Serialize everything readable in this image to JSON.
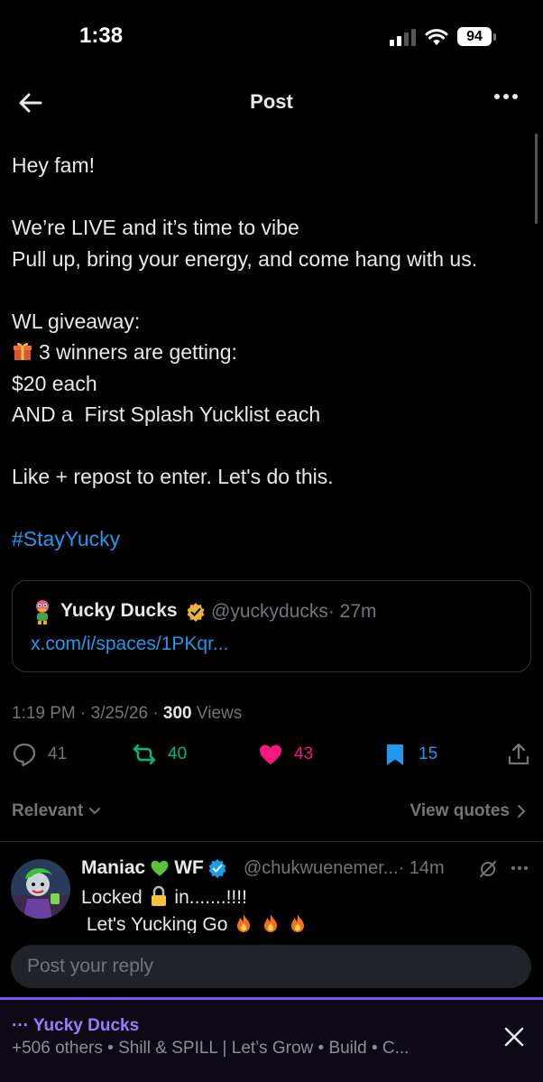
{
  "status_bar": {
    "time": "1:38",
    "battery": "94"
  },
  "nav": {
    "title": "Post"
  },
  "post": {
    "lines": [
      "Hey fam!",
      "",
      "We’re LIVE and it’s time to vibe",
      "Pull up, bring your energy, and come hang with us.",
      "",
      "WL giveaway:",
      "3 winners are getting:",
      "$20 each",
      "AND a  First Splash Yucklist each",
      "",
      "Like + repost to enter. Let's do this.",
      ""
    ],
    "hashtag": "#StayYucky"
  },
  "quote": {
    "name": "Yucky Ducks",
    "handle": "@yuckyducks",
    "time": "· 27m",
    "link": "x.com/i/spaces/1PKqr..."
  },
  "meta": {
    "time": "1:19 PM · 3/25/26 · ",
    "views_count": "300",
    "views_label": " Views"
  },
  "actions": {
    "replies": "41",
    "reposts": "40",
    "likes": "43",
    "bookmarks": "15"
  },
  "sort": {
    "left": "Relevant",
    "right": "View quotes"
  },
  "reply": {
    "name": "Maniac",
    "name_suffix": "WF",
    "handle": "@chukwuenemer...",
    "time": "· 14m",
    "line1_a": "Locked ",
    "line1_b": " in.......!!!!",
    "line2": " Let's Yucking Go "
  },
  "reply_input": {
    "placeholder": "Post your reply"
  },
  "space": {
    "title": "··· Yucky Ducks",
    "subtitle": "+506 others • Shill & SPILL | Let’s Grow • Build • C..."
  },
  "icons": {
    "back": "arrow-left-icon",
    "more": "more-horizontal-icon",
    "reply": "reply-bubble-icon",
    "repost": "repost-icon",
    "like": "heart-filled-icon",
    "bookmark": "bookmark-filled-icon",
    "share": "share-icon",
    "close": "close-icon"
  },
  "colors": {
    "background": "#000000",
    "text": "#e7e9ea",
    "muted": "#71767b",
    "link": "#1d9bf0",
    "repost": "#00ba7c",
    "like": "#f91880",
    "bookmark": "#1d9bf0",
    "space_accent": "#7856ff"
  }
}
